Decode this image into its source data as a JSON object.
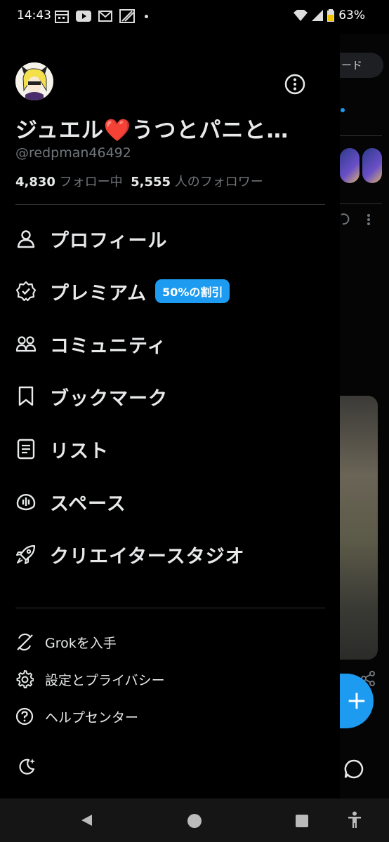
{
  "status_bar": {
    "time": "14:43",
    "battery": "63%"
  },
  "background": {
    "pill_text": "ード"
  },
  "profile": {
    "display_name": "ジュエル❤️うつとパニと…",
    "handle": "@redpman46492",
    "following_count": "4,830",
    "following_label": "フォロー中",
    "followers_count": "5,555",
    "followers_label": "人のフォロワー"
  },
  "menu": {
    "items": [
      {
        "label": "プロフィール",
        "icon": "person-icon"
      },
      {
        "label": "プレミアム",
        "icon": "verified-badge-icon",
        "badge": "50%の割引"
      },
      {
        "label": "コミュニティ",
        "icon": "people-icon"
      },
      {
        "label": "ブックマーク",
        "icon": "bookmark-icon"
      },
      {
        "label": "リスト",
        "icon": "list-icon"
      },
      {
        "label": "スペース",
        "icon": "microphone-icon"
      },
      {
        "label": "クリエイタースタジオ",
        "icon": "rocket-icon"
      }
    ],
    "secondary": [
      {
        "label": "Grokを入手",
        "icon": "grok-icon"
      },
      {
        "label": "設定とプライバシー",
        "icon": "gear-icon"
      },
      {
        "label": "ヘルプセンター",
        "icon": "help-icon"
      }
    ]
  },
  "colors": {
    "accent": "#1d9bf0",
    "text": "#e7e9ea",
    "muted": "#71767b",
    "divider": "#2f3336"
  }
}
